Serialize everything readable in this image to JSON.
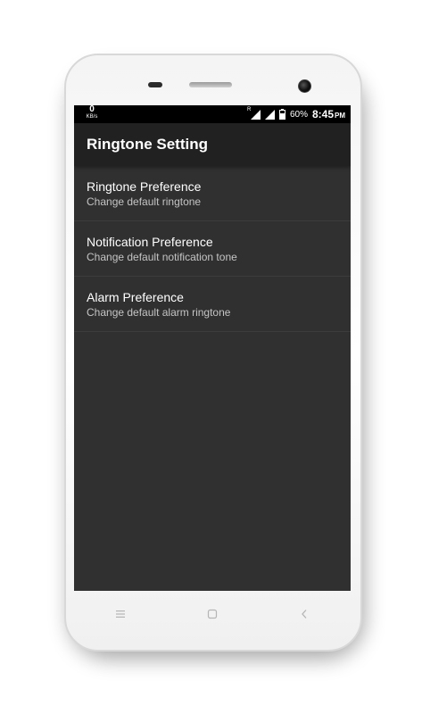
{
  "statusbar": {
    "net_speed_value": "0",
    "net_speed_unit": "KB/s",
    "roaming_indicator": "R",
    "battery_percent": "60%",
    "time": "8:45",
    "ampm": "PM"
  },
  "appbar": {
    "title": "Ringtone Setting"
  },
  "preferences": [
    {
      "title": "Ringtone Preference",
      "summary": "Change default ringtone"
    },
    {
      "title": "Notification Preference",
      "summary": "Change default notification tone"
    },
    {
      "title": "Alarm Preference",
      "summary": "Change default alarm ringtone"
    }
  ],
  "navbar": {
    "icons": [
      "menu-icon",
      "home-icon",
      "back-icon"
    ]
  },
  "colors": {
    "screen_bg": "#303030",
    "appbar_bg": "#212121",
    "statusbar_bg": "#000000"
  }
}
